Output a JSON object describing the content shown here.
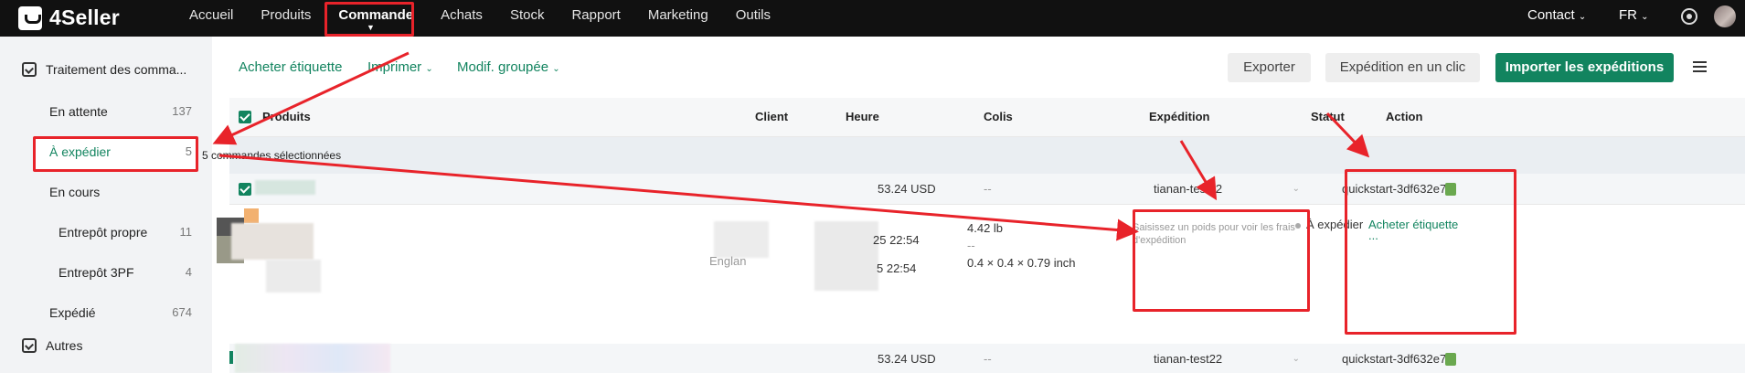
{
  "brand": {
    "name": "4Seller"
  },
  "nav": {
    "items": [
      "Accueil",
      "Produits",
      "Commande",
      "Achats",
      "Stock",
      "Rapport",
      "Marketing",
      "Outils"
    ],
    "active_index": 2,
    "contact": "Contact",
    "language": "FR"
  },
  "sidebar": {
    "group1": "Traitement des comma...",
    "items": [
      {
        "label": "En attente",
        "count": "137"
      },
      {
        "label": "À expédier",
        "count": "5"
      },
      {
        "label": "En cours",
        "count": ""
      },
      {
        "label": "Entrepôt propre",
        "count": "11"
      },
      {
        "label": "Entrepôt 3PF",
        "count": "4"
      },
      {
        "label": "Expédié",
        "count": "674"
      }
    ],
    "group2": "Autres"
  },
  "toolbar": {
    "buy_label": "Acheter étiquette",
    "print_label": "Imprimer",
    "bulk_label": "Modif. groupée",
    "export_label": "Exporter",
    "oneclick_label": "Expédition en un clic",
    "import_label": "Importer les expéditions"
  },
  "table": {
    "headers": {
      "products": "Produits",
      "client": "Client",
      "time": "Heure",
      "parcel": "Colis",
      "shipping": "Expédition",
      "status": "Statut",
      "action": "Action"
    },
    "selection_text": "5 commandes sélectionnées",
    "orders": [
      {
        "price": "53.24 USD",
        "parcel": "--",
        "shipping": "tianan-test22",
        "store": "quickstart-3df632e7"
      },
      {
        "price": "53.24 USD",
        "parcel": "--",
        "shipping": "tianan-test22",
        "store": "quickstart-3df632e7"
      }
    ],
    "detail": {
      "client_partial": "Englan",
      "time1": "25 22:54",
      "time2": "5 22:54",
      "weight": "4.42 lb",
      "weight_sep": "--",
      "dimensions": "0.4 × 0.4 × 0.79 inch",
      "shipping_hint": "Saisissez un poids pour voir les frais d'expédition",
      "status": "À expédier",
      "action": "Acheter étiquette",
      "more": "..."
    }
  },
  "colors": {
    "accent": "#12845f",
    "annotation": "#e8232a",
    "topbar": "#111111"
  }
}
